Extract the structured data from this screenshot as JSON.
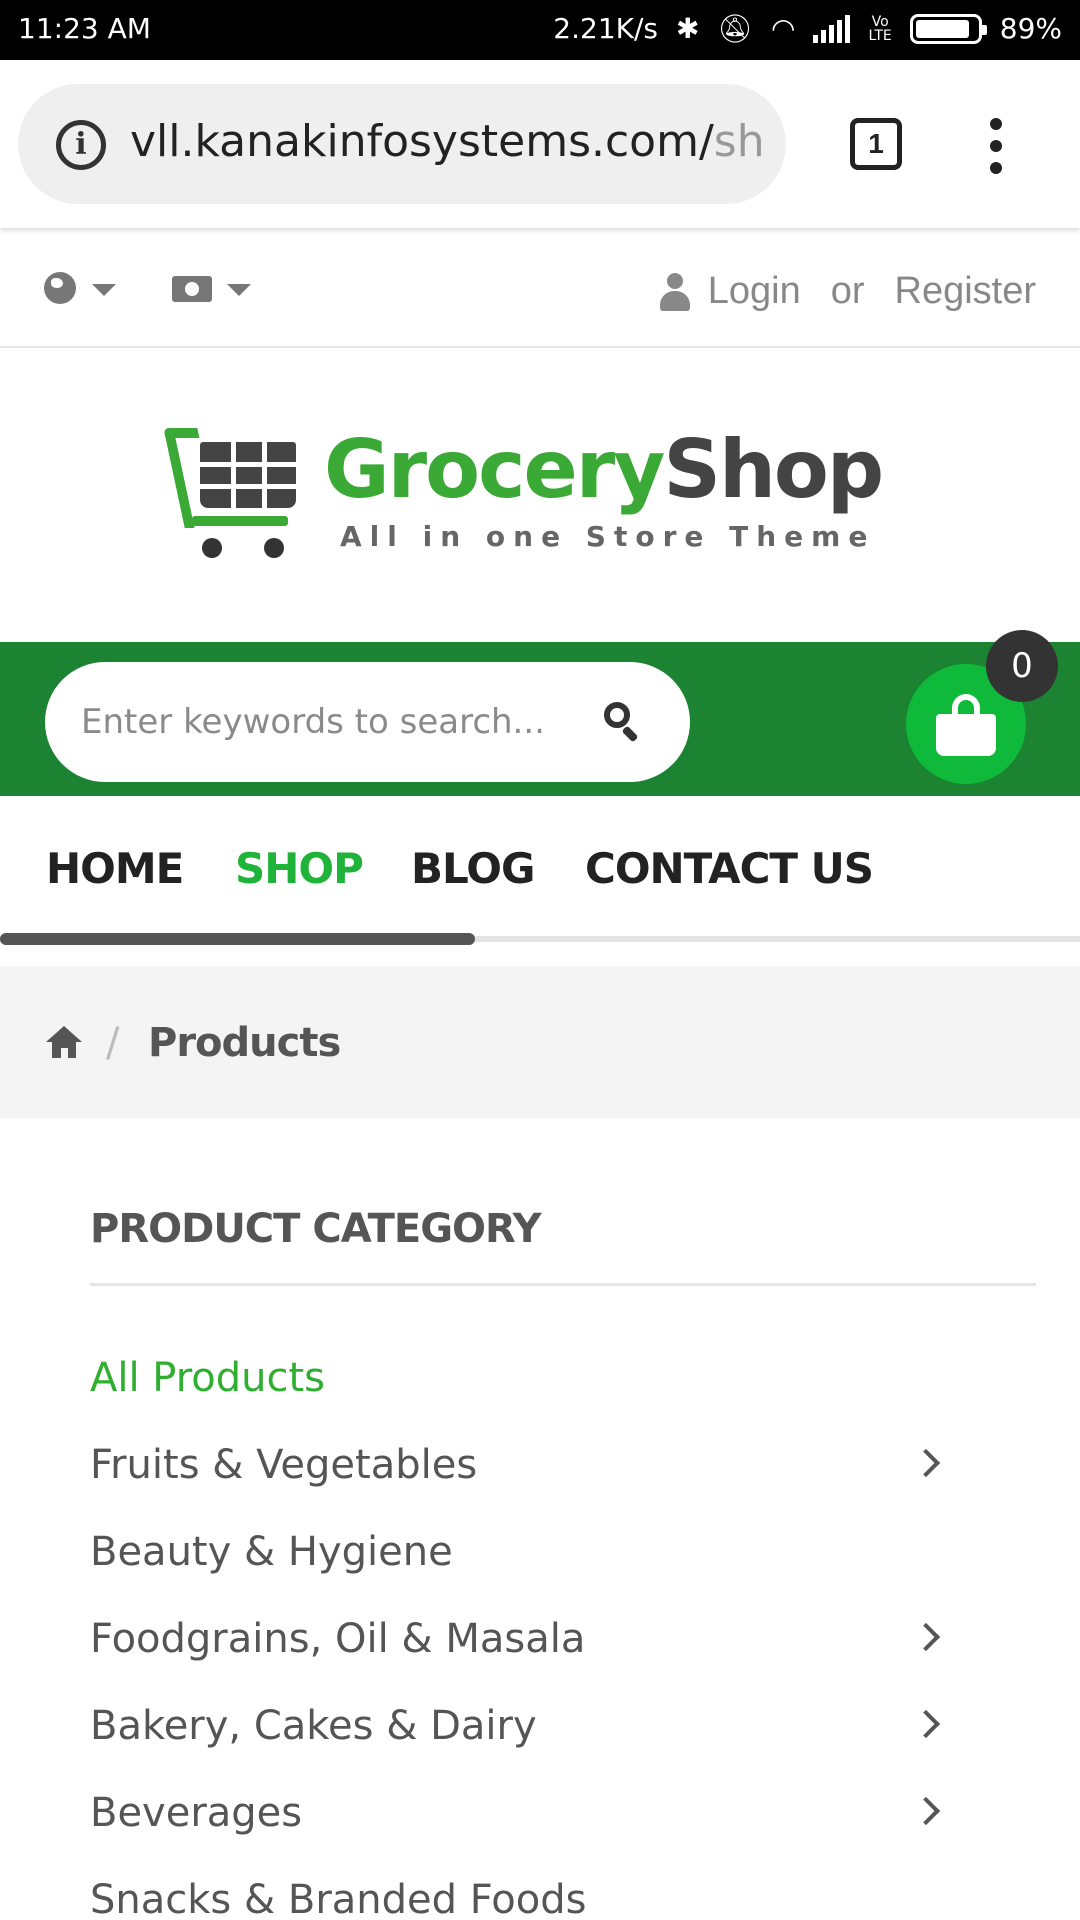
{
  "status_bar": {
    "time": "11:23 AM",
    "net_speed": "2.21K/s",
    "volte": "VoLTE",
    "battery": "89%",
    "battery_level": 0.89
  },
  "browser": {
    "url_main": "vll.kanakinfosystems.com/",
    "url_dim": "sh",
    "tab_count": "1"
  },
  "utility": {
    "login": "Login",
    "or": "or",
    "register": "Register"
  },
  "logo": {
    "brand_green": "Grocery",
    "brand_dark": "Shop",
    "tagline": "All in one Store Theme"
  },
  "search": {
    "placeholder": "Enter keywords to search...",
    "cart_count": "0"
  },
  "nav": {
    "items": [
      "HOME",
      "SHOP",
      "BLOG",
      "CONTACT US"
    ],
    "active": "SHOP",
    "scroll_fraction": 0.44
  },
  "breadcrumb": {
    "separator": "/",
    "current": "Products"
  },
  "categories": {
    "heading": "PRODUCT CATEGORY",
    "items": [
      {
        "label": "All Products",
        "has_children": false
      },
      {
        "label": "Fruits & Vegetables",
        "has_children": true
      },
      {
        "label": "Beauty & Hygiene",
        "has_children": false
      },
      {
        "label": "Foodgrains, Oil & Masala",
        "has_children": true
      },
      {
        "label": "Bakery, Cakes & Dairy",
        "has_children": true
      },
      {
        "label": "Beverages",
        "has_children": true
      },
      {
        "label": "Snacks & Branded Foods",
        "has_children": false
      }
    ]
  },
  "colors": {
    "brand_green": "#3aa935",
    "band_green": "#1b8331",
    "cart_green": "#0fb93a",
    "active_link": "#1fb33a"
  }
}
